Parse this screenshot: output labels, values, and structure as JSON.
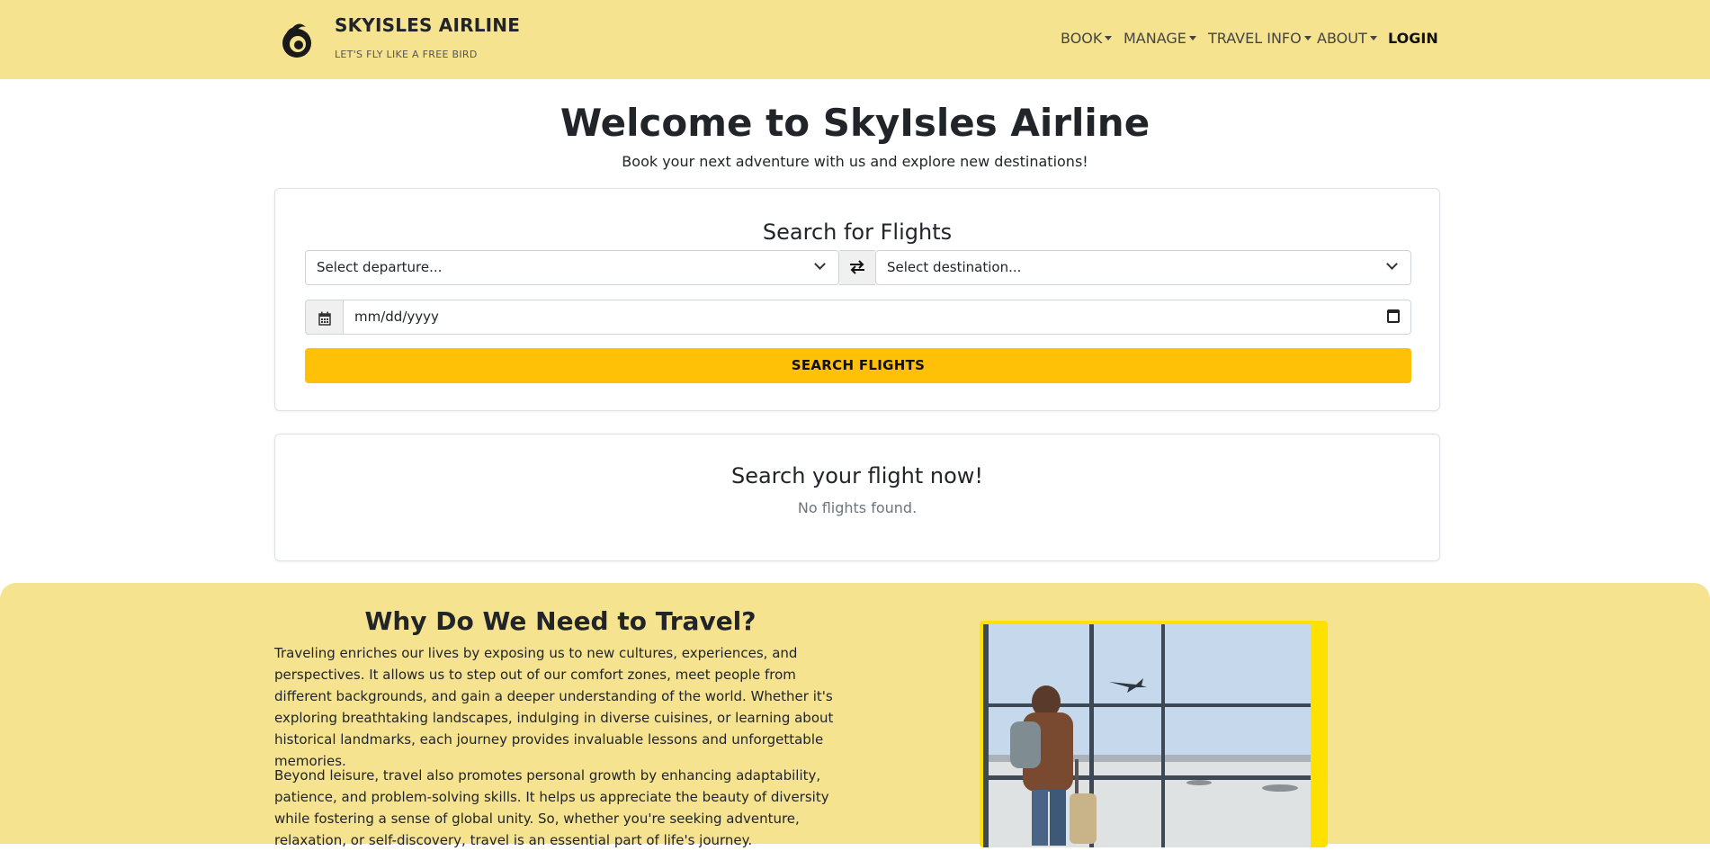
{
  "brand": {
    "name": "SKYISLES AIRLINE",
    "tagline": "LET'S FLY LIKE A FREE BIRD",
    "logo_icon": "bird-swirl-icon"
  },
  "nav": {
    "book": "BOOK",
    "manage": "MANAGE",
    "travel_info": "TRAVEL INFO",
    "about": "ABOUT",
    "login": "LOGIN"
  },
  "hero": {
    "title": "Welcome to SkyIsles Airline",
    "subtitle": "Book your next adventure with us and explore new destinations!"
  },
  "search": {
    "title": "Search for Flights",
    "departure_placeholder": "Select departure...",
    "destination_placeholder": "Select destination...",
    "date_placeholder": "mm/dd/yyyy",
    "button": "SEARCH FLIGHTS"
  },
  "results": {
    "title": "Search your flight now!",
    "message": "No flights found."
  },
  "why": {
    "title": "Why Do We Need to Travel?",
    "paragraph1": "Traveling enriches our lives by exposing us to new cultures, experiences, and perspectives. It allows us to step out of our comfort zones, meet people from different backgrounds, and gain a deeper understanding of the world. Whether it's exploring breathtaking landscapes, indulging in diverse cuisines, or learning about historical landmarks, each journey provides invaluable lessons and unforgettable memories.",
    "paragraph2": "Beyond leisure, travel also promotes personal growth by enhancing adaptability, patience, and problem-solving skills. It helps us appreciate the beauty of diversity while fostering a sense of global unity. So, whether you're seeking adventure, relaxation, or self-discovery, travel is an essential part of life's journey."
  },
  "colors": {
    "header_bg": "#f6e38f",
    "accent": "#ffc107",
    "photo_border": "#ffe100"
  }
}
